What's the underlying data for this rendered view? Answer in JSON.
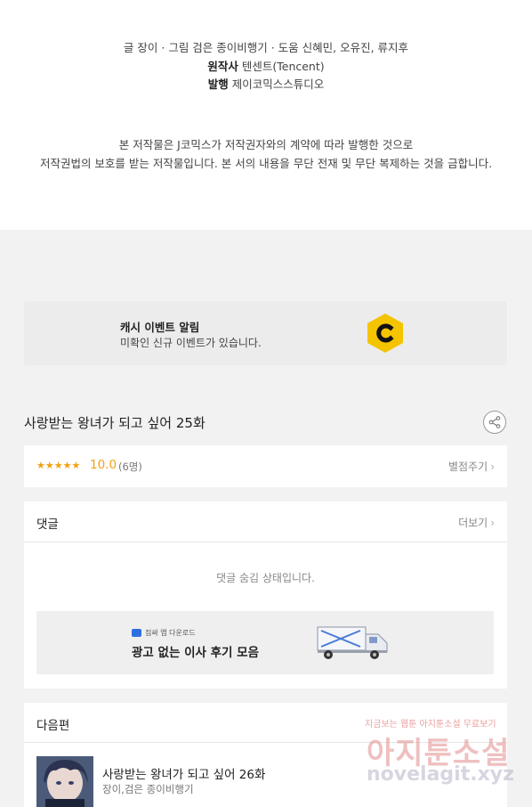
{
  "credits": {
    "line1": "글 장이 · 그림 검은 종이비행기 · 도움 신혜민, 오유진, 류지후",
    "original_label": "원작사",
    "original_value": "텐센트(Tencent)",
    "publisher_label": "발행",
    "publisher_value": "제이코믹스스튜디오",
    "copyright1": "본 저작물은 J코믹스가 저작권자와의 계약에 따라 발행한 것으로",
    "copyright2": "저작권법의 보호를 받는 저작물입니다. 본 서의 내용을 무단 전재 및 무단 복제하는 것을 금합니다."
  },
  "cash_banner": {
    "title": "캐시 이벤트 알림",
    "subtitle": "미확인 신규 이벤트가 있습니다.",
    "icon": "c-coin-icon",
    "icon_color": "#f5c400"
  },
  "episode": {
    "title": "사랑받는 왕녀가 되고 싶어 25화",
    "share_icon": "share-icon"
  },
  "rating": {
    "stars": "★★★★★",
    "score": "10.0",
    "count": "(6명)",
    "rate_label": "별점주기",
    "accent": "#f3a012"
  },
  "comments": {
    "title": "댓글",
    "more_label": "더보기",
    "hidden_message": "댓글 숨김 상태입니다."
  },
  "ad": {
    "badge_text": "짐싸 앱 다운로드",
    "text": "광고 없는 이사 후기 모음"
  },
  "next": {
    "title": "다음편",
    "episode_title": "사랑받는 왕녀가 되고 싶어 26화",
    "authors": "장이,검은 종이비행기"
  },
  "watermark": {
    "top": "지금보는 웹툰 아지툰소설 무료보기",
    "main": "아지툰소설",
    "site": "novelagit.xyz"
  }
}
